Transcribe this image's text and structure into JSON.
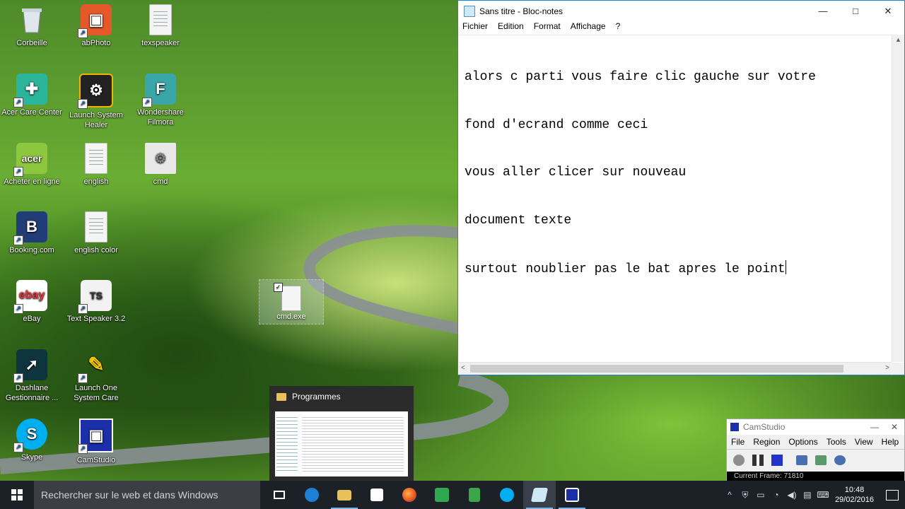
{
  "desktop": {
    "icons": [
      {
        "label": "Corbeille",
        "icon": "recycle-bin-icon"
      },
      {
        "label": "abPhoto",
        "icon": "photo-app-icon"
      },
      {
        "label": "texspeaker",
        "icon": "text-file-icon"
      },
      {
        "label": "Acer Care Center",
        "icon": "acer-care-icon"
      },
      {
        "label": "Launch System Healer",
        "icon": "system-healer-icon"
      },
      {
        "label": "Wondershare Filmora",
        "icon": "filmora-icon"
      },
      {
        "label": "Acheter en ligne",
        "icon": "acer-shop-icon"
      },
      {
        "label": "english",
        "icon": "text-file-icon"
      },
      {
        "label": "cmd",
        "icon": "batch-file-icon"
      },
      {
        "label": "Booking.com",
        "icon": "booking-icon"
      },
      {
        "label": "english color",
        "icon": "document-icon"
      },
      {
        "label": "eBay",
        "icon": "ebay-icon"
      },
      {
        "label": "Text Speaker 3.2",
        "icon": "text-speaker-icon"
      },
      {
        "label": "Dashlane Gestionnaire ...",
        "icon": "dashlane-icon"
      },
      {
        "label": "Launch One System Care",
        "icon": "one-system-care-icon"
      },
      {
        "label": "Skype",
        "icon": "skype-icon"
      },
      {
        "label": "CamStudio",
        "icon": "camstudio-icon"
      }
    ],
    "dragged_file": {
      "label": "cmd.exe",
      "check": "✓"
    }
  },
  "notepad": {
    "title": "Sans titre - Bloc-notes",
    "menu": [
      "Fichier",
      "Edition",
      "Format",
      "Affichage",
      "?"
    ],
    "lines": [
      "alors c parti vous faire clic gauche sur votre",
      "fond d'ecrand comme ceci",
      "vous aller clicer sur nouveau",
      "document texte",
      "surtout noublier pas le bat apres le point"
    ]
  },
  "taskbar_preview": {
    "title": "Programmes"
  },
  "camstudio": {
    "title": "CamStudio",
    "menu": [
      "File",
      "Region",
      "Options",
      "Tools",
      "View",
      "Help"
    ],
    "status": "Current Frame: 71810"
  },
  "taskbar": {
    "search_placeholder": "Rechercher sur le web et dans Windows",
    "time": "10:48",
    "date": "29/02/2016"
  },
  "colors": {
    "accent": "#1883d7",
    "taskbar_bg": "#1c2128"
  }
}
